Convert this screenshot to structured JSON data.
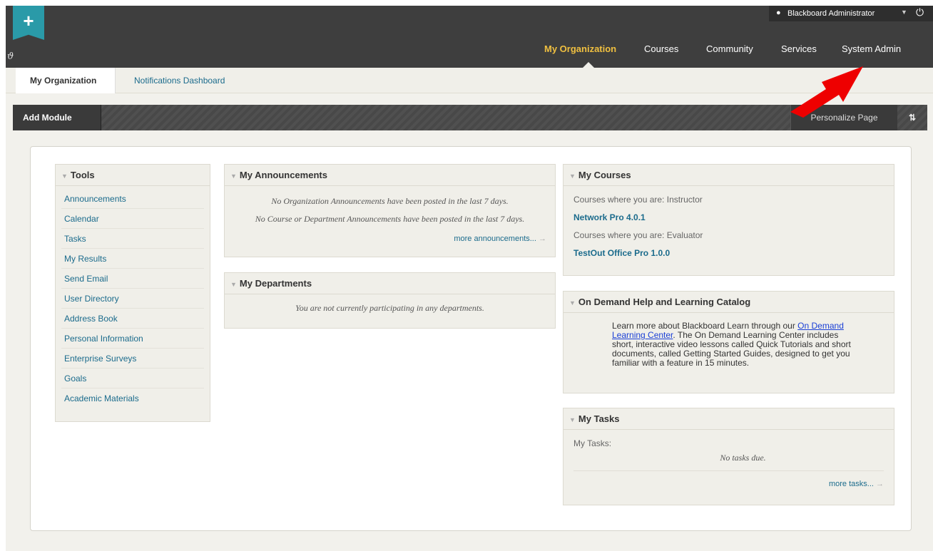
{
  "header": {
    "user_name": "Blackboard Administrator",
    "nav": [
      {
        "label": "My Organization",
        "active": true
      },
      {
        "label": "Courses"
      },
      {
        "label": "Community"
      },
      {
        "label": "Services"
      },
      {
        "label": "System Admin"
      }
    ]
  },
  "subnav": {
    "tabs": [
      {
        "label": "My Organization",
        "active": true
      },
      {
        "label": "Notifications Dashboard"
      }
    ]
  },
  "actionbar": {
    "add_module": "Add Module",
    "personalize": "Personalize Page",
    "reorder": "⇅"
  },
  "modules": {
    "tools": {
      "title": "Tools",
      "items": [
        "Announcements",
        "Calendar",
        "Tasks",
        "My Results",
        "Send Email",
        "User Directory",
        "Address Book",
        "Personal Information",
        "Enterprise Surveys",
        "Goals",
        "Academic Materials"
      ]
    },
    "announcements": {
      "title": "My Announcements",
      "line1": "No Organization Announcements have been posted in the last 7 days.",
      "line2": "No Course or Department Announcements have been posted in the last 7 days.",
      "more": "more announcements..."
    },
    "departments": {
      "title": "My Departments",
      "note": "You are not currently participating in any departments."
    },
    "courses": {
      "title": "My Courses",
      "instructor_label": "Courses where you are: Instructor",
      "instructor_course": "Network Pro 4.0.1",
      "evaluator_label": "Courses where you are: Evaluator",
      "evaluator_course": "TestOut Office Pro 1.0.0"
    },
    "help": {
      "title": "On Demand Help and Learning Catalog",
      "text_before": "Learn more about Blackboard Learn through our ",
      "link": "On Demand Learning Center",
      "text_after": ". The On Demand Learning Center includes short, interactive video lessons called Quick Tutorials and short documents, called Getting Started Guides, designed to get you familiar with a feature in 15 minutes."
    },
    "tasks": {
      "title": "My Tasks",
      "label": "My Tasks:",
      "note": "No tasks due.",
      "more": "more tasks..."
    }
  },
  "colors": {
    "header_bg": "#3e3e3e",
    "active_nav": "#f0c040",
    "link": "#1b6b8c",
    "module_bg": "#f0efe9",
    "annotation_arrow": "#ee0000"
  }
}
